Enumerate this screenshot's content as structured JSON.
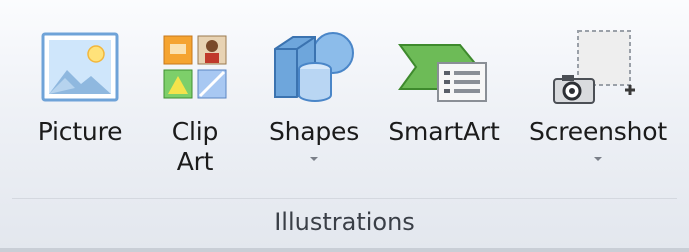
{
  "ribbon": {
    "group_label": "Illustrations",
    "buttons": [
      {
        "id": "picture",
        "label_lines": [
          "Picture"
        ],
        "icon": "picture-icon",
        "has_dropdown": false
      },
      {
        "id": "clip-art",
        "label_lines": [
          "Clip",
          "Art"
        ],
        "icon": "clip-art-icon",
        "has_dropdown": false
      },
      {
        "id": "shapes",
        "label_lines": [
          "Shapes"
        ],
        "icon": "shapes-icon",
        "has_dropdown": true
      },
      {
        "id": "smartart",
        "label_lines": [
          "SmartArt"
        ],
        "icon": "smartart-icon",
        "has_dropdown": false
      },
      {
        "id": "screenshot",
        "label_lines": [
          "Screenshot"
        ],
        "icon": "screenshot-icon",
        "has_dropdown": true
      }
    ]
  },
  "colors": {
    "picture_frame": "#6fa3d8",
    "smartart_green": "#5aa845",
    "shapes_blue": "#4a86c8",
    "caret": "#7a7f88"
  }
}
